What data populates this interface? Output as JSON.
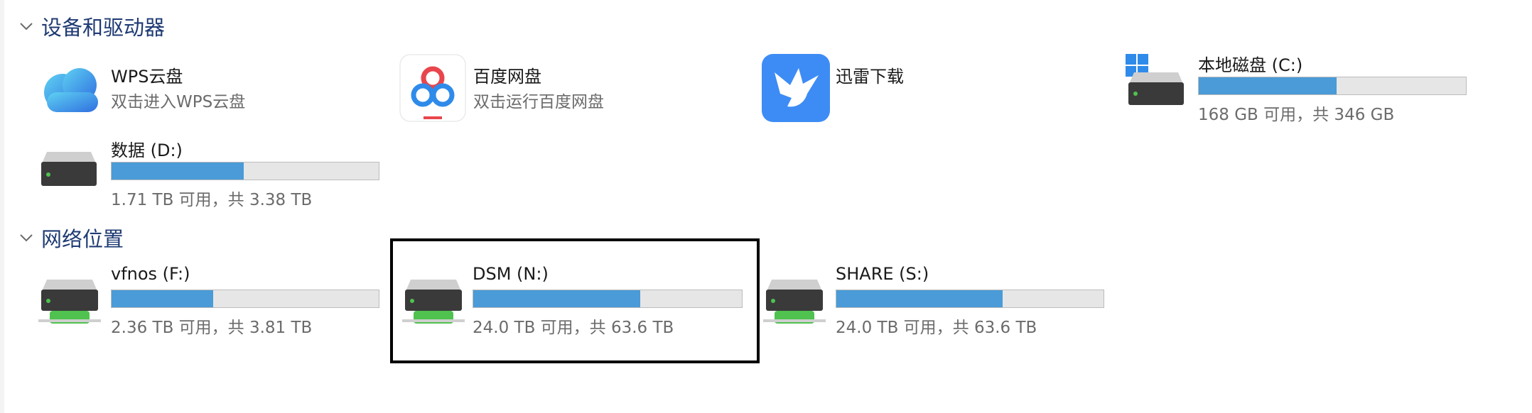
{
  "sections": {
    "devices": {
      "title": "设备和驱动器"
    },
    "network": {
      "title": "网络位置"
    }
  },
  "devices": {
    "wps": {
      "name": "WPS云盘",
      "subtitle": "双击进入WPS云盘",
      "icon": "wps-cloud-icon"
    },
    "baidu": {
      "name": "百度网盘",
      "subtitle": "双击运行百度网盘",
      "icon": "baidu-netdisk-icon"
    },
    "xunlei": {
      "name": "迅雷下载",
      "icon": "xunlei-bird-icon"
    },
    "c_drive": {
      "name": "本地磁盘 (C:)",
      "usage": "168 GB 可用，共 346 GB",
      "used_fraction": 0.515,
      "icon": "windows-drive-icon"
    },
    "d_drive": {
      "name": "数据 (D:)",
      "usage": "1.71 TB 可用，共 3.38 TB",
      "used_fraction": 0.494,
      "icon": "hard-drive-icon"
    }
  },
  "network": {
    "f_drive": {
      "name": "vfnos (F:)",
      "usage": "2.36 TB 可用，共 3.81 TB",
      "used_fraction": 0.381,
      "icon": "network-drive-icon"
    },
    "n_drive": {
      "name": "DSM (N:)",
      "usage": "24.0 TB 可用，共 63.6 TB",
      "used_fraction": 0.623,
      "icon": "network-drive-icon",
      "selected": true
    },
    "s_drive": {
      "name": "SHARE (S:)",
      "usage": "24.0 TB 可用，共 63.6 TB",
      "used_fraction": 0.623,
      "icon": "network-drive-icon"
    }
  },
  "colors": {
    "accent": "#4a9bd7",
    "section_title": "#1f3b73",
    "network_green": "#4fc24f"
  }
}
